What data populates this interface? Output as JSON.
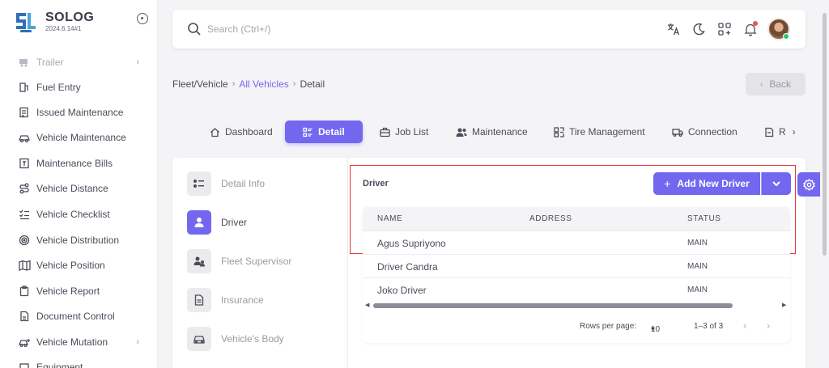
{
  "brand": {
    "name": "SOLOG",
    "version": "2024.6.14#1"
  },
  "sidebar": {
    "items": [
      {
        "label": "Trailer",
        "icon": "trailer-icon",
        "faded": true,
        "chevron": true
      },
      {
        "label": "Fuel Entry",
        "icon": "fuel-icon"
      },
      {
        "label": "Issued Maintenance",
        "icon": "issued-maintenance-icon"
      },
      {
        "label": "Vehicle Maintenance",
        "icon": "vehicle-maintenance-icon"
      },
      {
        "label": "Maintenance Bills",
        "icon": "bill-icon"
      },
      {
        "label": "Vehicle Distance",
        "icon": "route-icon"
      },
      {
        "label": "Vehicle Checklist",
        "icon": "checklist-icon"
      },
      {
        "label": "Vehicle Distribution",
        "icon": "distribution-icon"
      },
      {
        "label": "Vehicle Position",
        "icon": "map-icon"
      },
      {
        "label": "Vehicle Report",
        "icon": "clipboard-icon"
      },
      {
        "label": "Document Control",
        "icon": "document-icon"
      },
      {
        "label": "Vehicle Mutation",
        "icon": "mutation-icon",
        "chevron": true
      },
      {
        "label": "Equipment",
        "icon": "equipment-icon"
      }
    ]
  },
  "search": {
    "placeholder": "Search (Ctrl+/)"
  },
  "breadcrumb": {
    "root": "Fleet/Vehicle",
    "sep": "›",
    "link": "All Vehicles",
    "current": "Detail"
  },
  "back_label": "Back",
  "tabs": [
    {
      "label": "Dashboard",
      "icon": "home-icon"
    },
    {
      "label": "Detail",
      "icon": "list-details-icon",
      "active": true
    },
    {
      "label": "Job List",
      "icon": "briefcase-icon"
    },
    {
      "label": "Maintenance",
      "icon": "users-icon"
    },
    {
      "label": "Tire Management",
      "icon": "tire-icon"
    },
    {
      "label": "Connection",
      "icon": "truck-icon"
    },
    {
      "label": "R",
      "icon": "report-icon"
    }
  ],
  "detail_menu": [
    {
      "label": "Detail Info",
      "icon": "list-icon"
    },
    {
      "label": "Driver",
      "icon": "user-icon",
      "active": true
    },
    {
      "label": "Fleet Supervisor",
      "icon": "users-icon"
    },
    {
      "label": "Insurance",
      "icon": "file-icon"
    },
    {
      "label": "Vehicle's Body",
      "icon": "car-body-icon"
    }
  ],
  "driver": {
    "title": "Driver",
    "add_label": "Add New Driver",
    "columns": [
      "NAME",
      "ADDRESS",
      "STATUS"
    ],
    "rows": [
      {
        "name": "Agus Supriyono",
        "address": "",
        "status": "MAIN"
      },
      {
        "name": "Driver Candra",
        "address": "",
        "status": "MAIN"
      },
      {
        "name": "Joko Driver",
        "address": "",
        "status": "MAIN"
      }
    ],
    "pager": {
      "rows_label": "Rows per page:",
      "rows_value": "10",
      "range": "1–3 of 3"
    }
  },
  "colors": {
    "primary": "#7367f0",
    "highlight": "#e23a3a"
  }
}
